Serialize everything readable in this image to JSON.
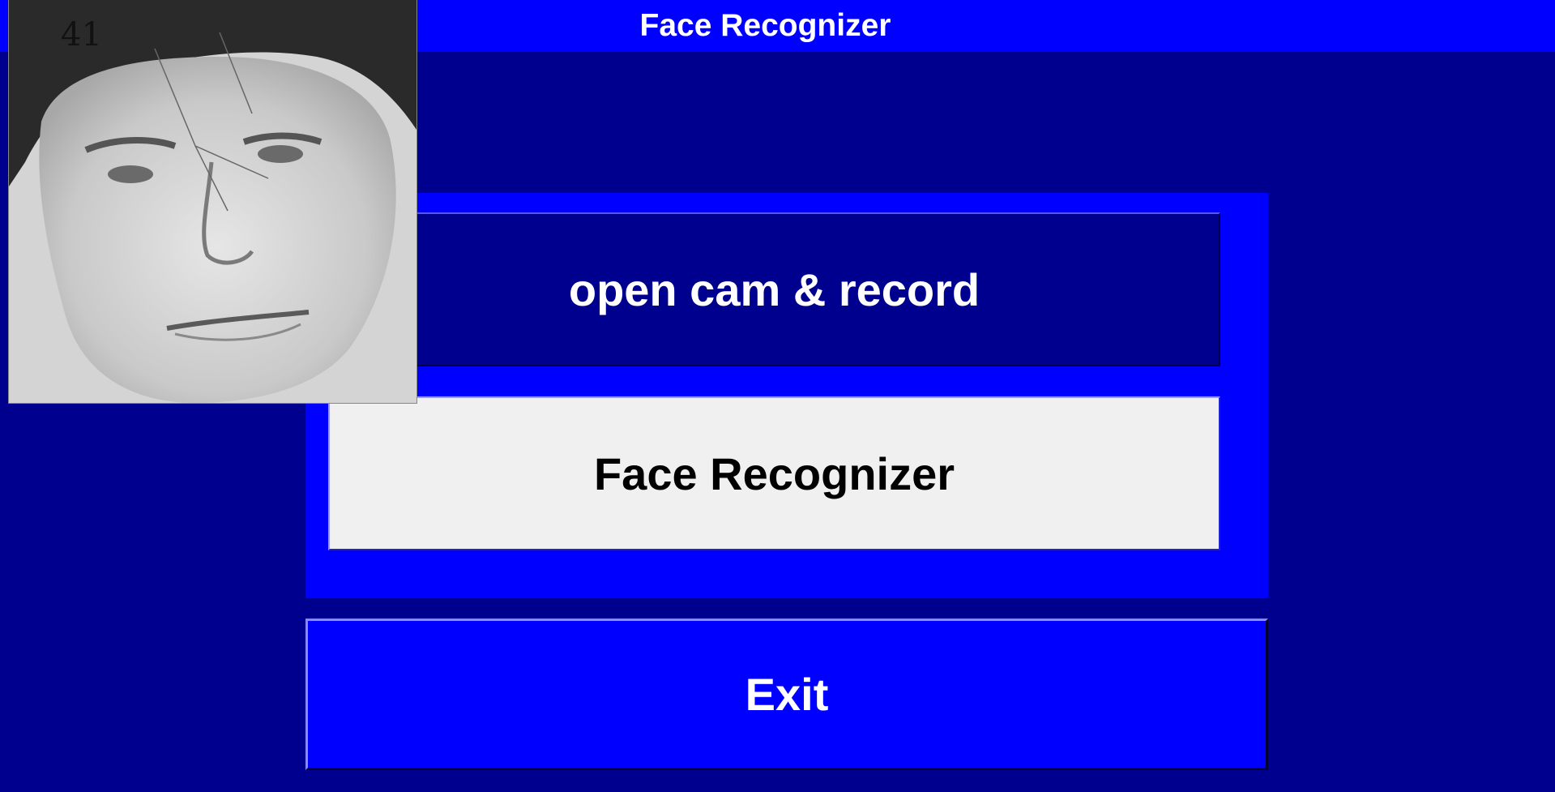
{
  "window": {
    "title": "Face Recognizer"
  },
  "buttons": {
    "record_label": "open cam & record",
    "recognizer_label": "Face Recognizer",
    "exit_label": "Exit"
  },
  "face_preview": {
    "frame_count": "41"
  },
  "colors": {
    "background": "#00008f",
    "accent": "#0000ff",
    "button_light": "#f0f0f0",
    "text_light": "#ffffff",
    "text_dark": "#000000"
  }
}
